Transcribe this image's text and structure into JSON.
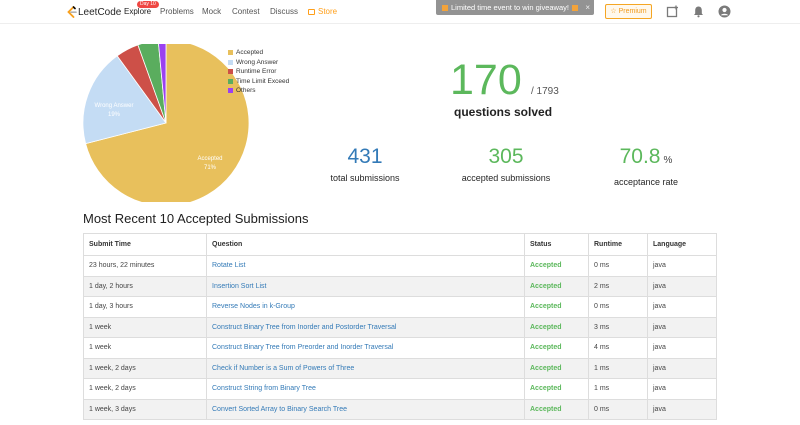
{
  "nav": {
    "logo_text": "LeetCode",
    "items": [
      "Explore",
      "Problems",
      "Mock",
      "Contest",
      "Discuss",
      "Store"
    ],
    "explore_badge": "Day 10",
    "promo_text": "Limited time event to win giveaway!",
    "promo_close": "×",
    "premium_label": "Premium",
    "icons": [
      "leetcode-logo-icon",
      "gift-icon",
      "store-bag-icon",
      "star-icon",
      "playground-icon",
      "bell-icon",
      "user-icon"
    ]
  },
  "pie": {
    "colors": {
      "accepted": "#e8c05c",
      "wrong_answer": "#c4dcf4",
      "runtime_error": "#cd5048",
      "time_limit": "#5aad5e",
      "others": "#9b41f0"
    },
    "slices": [
      {
        "name": "Accepted",
        "percent": 71,
        "color": "#e8c05c",
        "label": "Accepted",
        "label_pct": "71%"
      },
      {
        "name": "Wrong Answer",
        "percent": 19,
        "color": "#c4dcf4",
        "label": "Wrong Answer",
        "label_pct": "19%"
      },
      {
        "name": "Runtime Error",
        "percent": 4.5,
        "color": "#cd5048"
      },
      {
        "name": "Time Limit Exceed",
        "percent": 4,
        "color": "#5aad5e"
      },
      {
        "name": "Others",
        "percent": 1.5,
        "color": "#9b41f0"
      }
    ]
  },
  "legend": [
    "Accepted",
    "Wrong Answer",
    "Runtime Error",
    "Time Limit Exceed",
    "Others"
  ],
  "stats": {
    "solved": "170",
    "total_questions": "/ 1793",
    "solved_label": "questions solved",
    "total_submissions": "431",
    "total_submissions_label": "total submissions",
    "accepted_submissions": "305",
    "accepted_submissions_label": "accepted submissions",
    "acceptance_rate": "70.8",
    "acceptance_rate_unit": "%",
    "acceptance_rate_label": "acceptance rate",
    "colors": {
      "solved": "#5cb85c",
      "total": "#337ab7",
      "accepted": "#5cb85c",
      "rate": "#5cb85c"
    }
  },
  "recent": {
    "title": "Most Recent 10 Accepted Submissions",
    "headers": [
      "Submit Time",
      "Question",
      "Status",
      "Runtime",
      "Language"
    ],
    "rows": [
      [
        "23 hours, 22 minutes",
        "Rotate List",
        "Accepted",
        "0 ms",
        "java"
      ],
      [
        "1 day, 2 hours",
        "Insertion Sort List",
        "Accepted",
        "2 ms",
        "java"
      ],
      [
        "1 day, 3 hours",
        "Reverse Nodes in k-Group",
        "Accepted",
        "0 ms",
        "java"
      ],
      [
        "1 week",
        "Construct Binary Tree from Inorder and Postorder Traversal",
        "Accepted",
        "3 ms",
        "java"
      ],
      [
        "1 week",
        "Construct Binary Tree from Preorder and Inorder Traversal",
        "Accepted",
        "4 ms",
        "java"
      ],
      [
        "1 week, 2 days",
        "Check if Number is a Sum of Powers of Three",
        "Accepted",
        "1 ms",
        "java"
      ],
      [
        "1 week, 2 days",
        "Construct String from Binary Tree",
        "Accepted",
        "1 ms",
        "java"
      ],
      [
        "1 week, 3 days",
        "Convert Sorted Array to Binary Search Tree",
        "Accepted",
        "0 ms",
        "java"
      ]
    ]
  }
}
